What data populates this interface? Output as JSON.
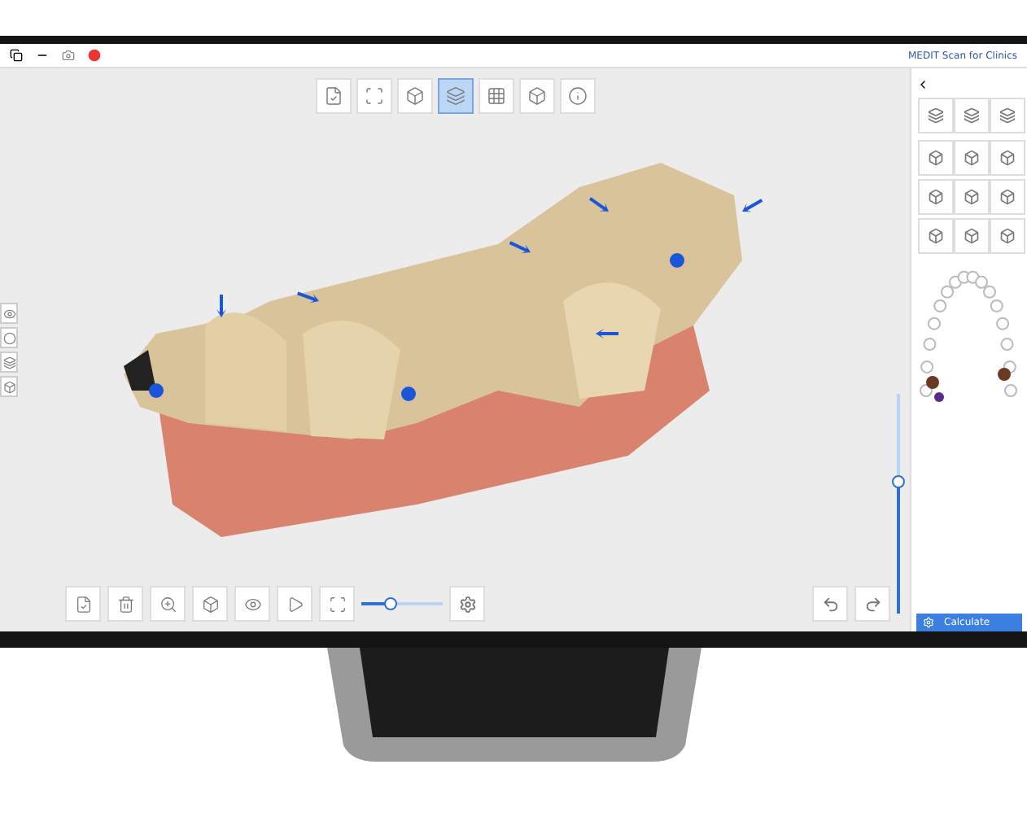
{
  "window": {
    "title": "MEDIT Scan for Clinics"
  },
  "top_tools": [
    {
      "selected": false
    },
    {
      "selected": false
    },
    {
      "selected": false
    },
    {
      "selected": true
    },
    {
      "selected": false
    },
    {
      "selected": false
    },
    {
      "selected": false
    }
  ],
  "depth_slider": {
    "level": 0.6
  },
  "bottom_slider": {
    "level": 0.35
  },
  "side_panel": {
    "calculate_button": "Calculate"
  }
}
